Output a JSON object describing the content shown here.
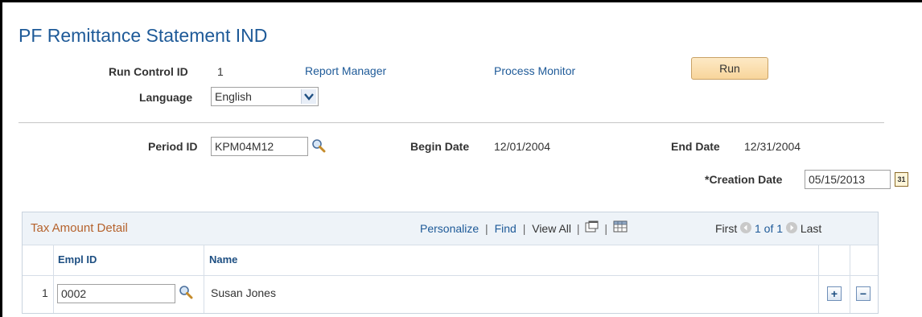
{
  "page": {
    "title": "PF Remittance Statement IND"
  },
  "run_control": {
    "run_control_id_label": "Run Control ID",
    "run_control_id_value": "1",
    "report_manager_link": "Report Manager",
    "process_monitor_link": "Process Monitor",
    "run_button": "Run",
    "language_label": "Language",
    "language_value": "English"
  },
  "params": {
    "period_id_label": "Period ID",
    "period_id_value": "KPM04M12",
    "begin_date_label": "Begin Date",
    "begin_date_value": "12/01/2004",
    "end_date_label": "End Date",
    "end_date_value": "12/31/2004",
    "creation_date_label": "*Creation Date",
    "creation_date_value": "05/15/2013",
    "calendar_icon_text": "31"
  },
  "grid": {
    "title": "Tax Amount Detail",
    "personalize": "Personalize",
    "find": "Find",
    "view_all": "View All",
    "sep": "|",
    "first": "First",
    "range": "1 of 1",
    "last": "Last",
    "col_empl_id": "Empl ID",
    "col_name": "Name",
    "rows": [
      {
        "num": "1",
        "empl_id": "0002",
        "name": "Susan Jones"
      }
    ],
    "add_symbol": "+",
    "remove_symbol": "−"
  }
}
